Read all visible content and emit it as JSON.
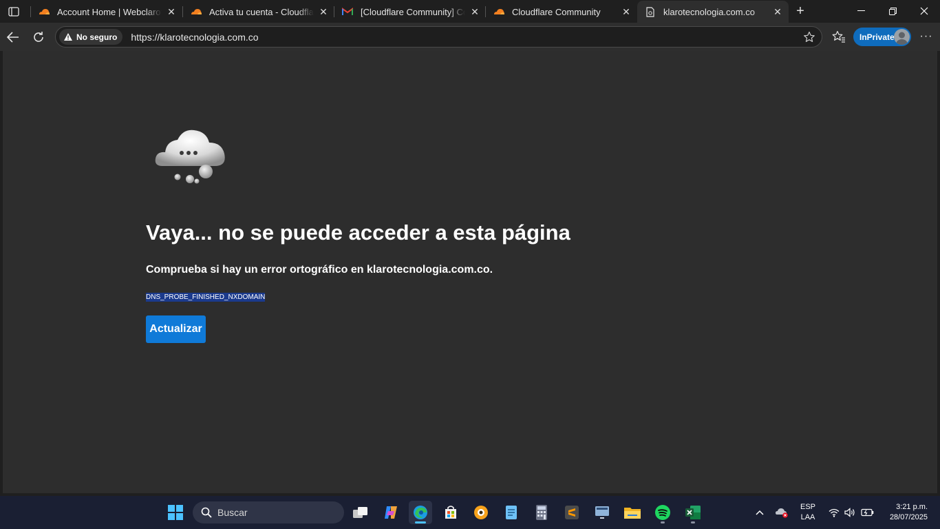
{
  "tabs": [
    {
      "title": "Account Home | Webclarotecnologia",
      "favicon": "cloudflare-icon"
    },
    {
      "title": "Activa tu cuenta - Cloudflare Community",
      "favicon": "cloudflare-icon"
    },
    {
      "title": "[Cloudflare Community] Confirm your account",
      "favicon": "gmail-icon"
    },
    {
      "title": "Cloudflare Community",
      "favicon": "cloudflare-icon"
    },
    {
      "title": "klarotecnologia.com.co",
      "favicon": "page-error-icon"
    }
  ],
  "toolbar": {
    "security_label": "No seguro",
    "url": "https://klarotecnologia.com.co",
    "inprivate_label": "InPrivate"
  },
  "error_page": {
    "title": "Vaya... no se puede acceder a esta página",
    "subtitle": "Comprueba si hay un error ortográfico en klarotecnologia.com.co.",
    "error_code": "DNS_PROBE_FINISHED_NXDOMAIN",
    "reload_label": "Actualizar"
  },
  "taskbar": {
    "search_placeholder": "Buscar",
    "lang_top": "ESP",
    "lang_bottom": "LAA",
    "time": "3:21 p.m.",
    "date": "28/07/2025"
  },
  "colors": {
    "accent": "#0f7ad8",
    "inprivate": "#0f6cbd",
    "content_bg": "#2d2d2d",
    "taskbar_bg": "#1a1f33"
  }
}
